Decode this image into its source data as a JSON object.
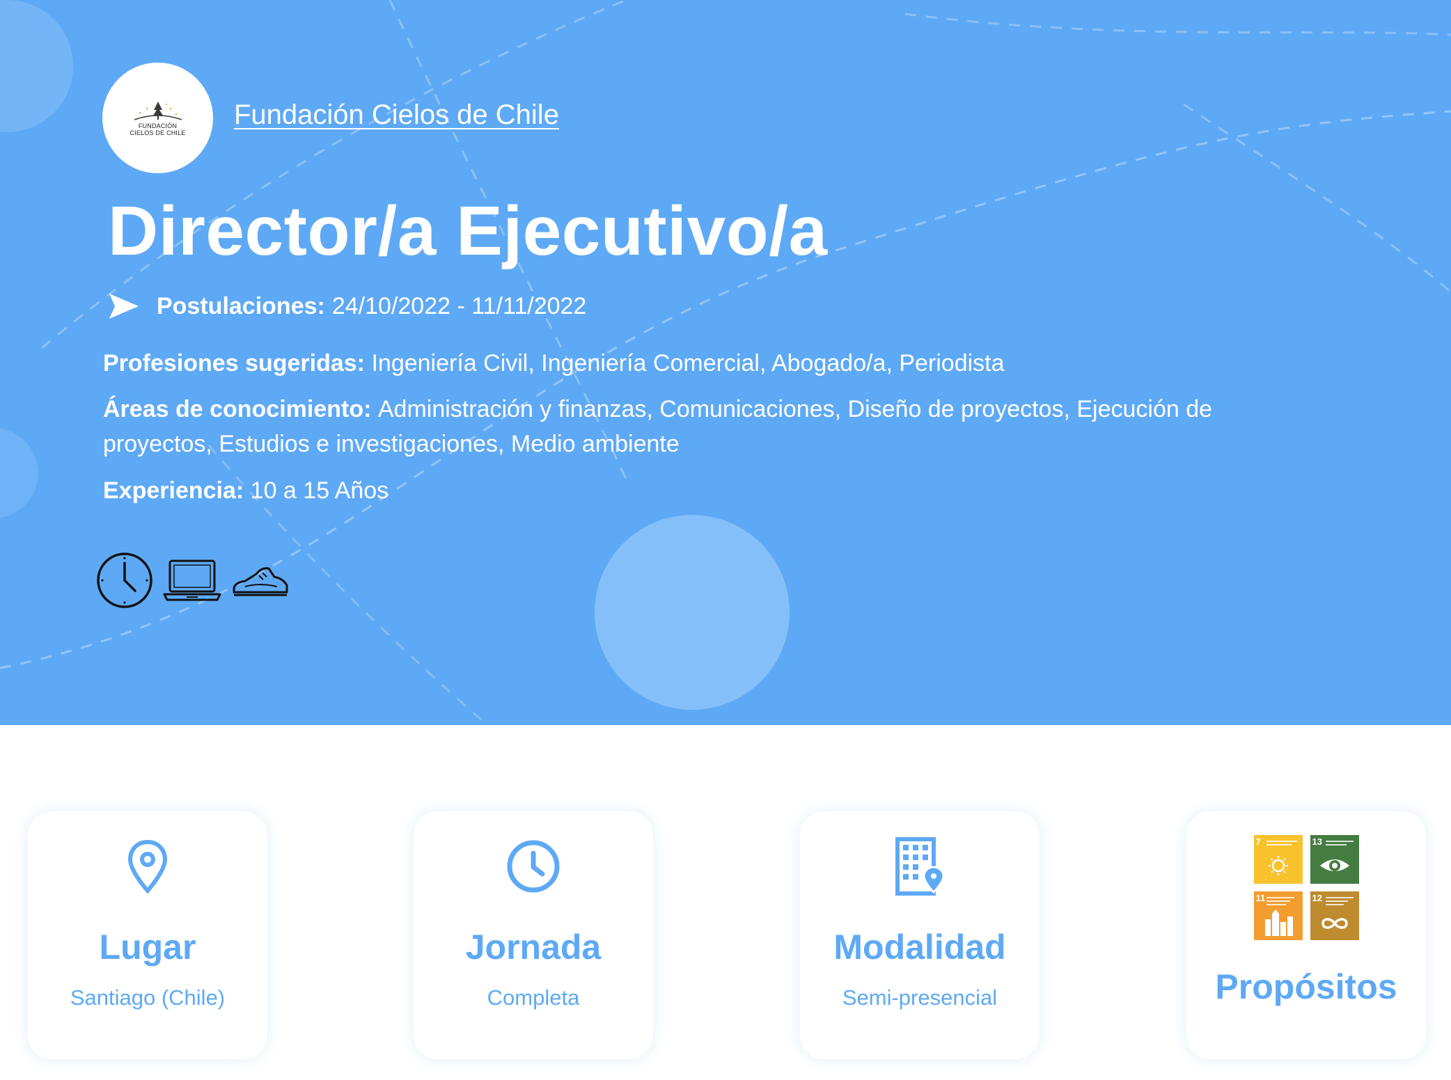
{
  "organization": {
    "name": "Fundación Cielos de Chile",
    "logo_text_line1": "FUNDACIÓN",
    "logo_text_line2": "CIELOS DE CHILE"
  },
  "job": {
    "title": "Director/a Ejecutivo/a"
  },
  "applications": {
    "label": "Postulaciones:",
    "value": "24/10/2022 - 11/11/2022",
    "icon": "send-icon"
  },
  "details": {
    "professions_label": "Profesiones sugeridas:",
    "professions_value": "Ingeniería Civil, Ingeniería Comercial, Abogado/a, Periodista",
    "areas_label": "Áreas de conocimiento:",
    "areas_value": "Administración y finanzas, Comunicaciones, Diseño de proyectos, Ejecución de proyectos, Estudios e investigaciones, Medio ambiente",
    "experience_label": "Experiencia:",
    "experience_value": "10 a 15 Años"
  },
  "feature_icons": [
    "clock-icon",
    "laptop-icon",
    "sneaker-icon"
  ],
  "cards": [
    {
      "title": "Lugar",
      "value": "Santiago (Chile)",
      "icon": "map-pin-icon"
    },
    {
      "title": "Jornada",
      "value": "Completa",
      "icon": "clock-icon"
    },
    {
      "title": "Modalidad",
      "value": "Semi-presencial",
      "icon": "building-location-icon"
    },
    {
      "title": "Propósitos",
      "sdgs": [
        {
          "number": "7",
          "color": "#f7c22c",
          "icon": "sun-icon"
        },
        {
          "number": "13",
          "color": "#457c42",
          "icon": "eye-earth-icon"
        },
        {
          "number": "11",
          "color": "#f39c30",
          "icon": "city-icon"
        },
        {
          "number": "12",
          "color": "#be8b2e",
          "icon": "infinity-icon"
        }
      ]
    }
  ],
  "colors": {
    "hero_background": "#5ea9f5",
    "accent": "#5ea9f5",
    "text_on_hero": "#ffffff"
  }
}
